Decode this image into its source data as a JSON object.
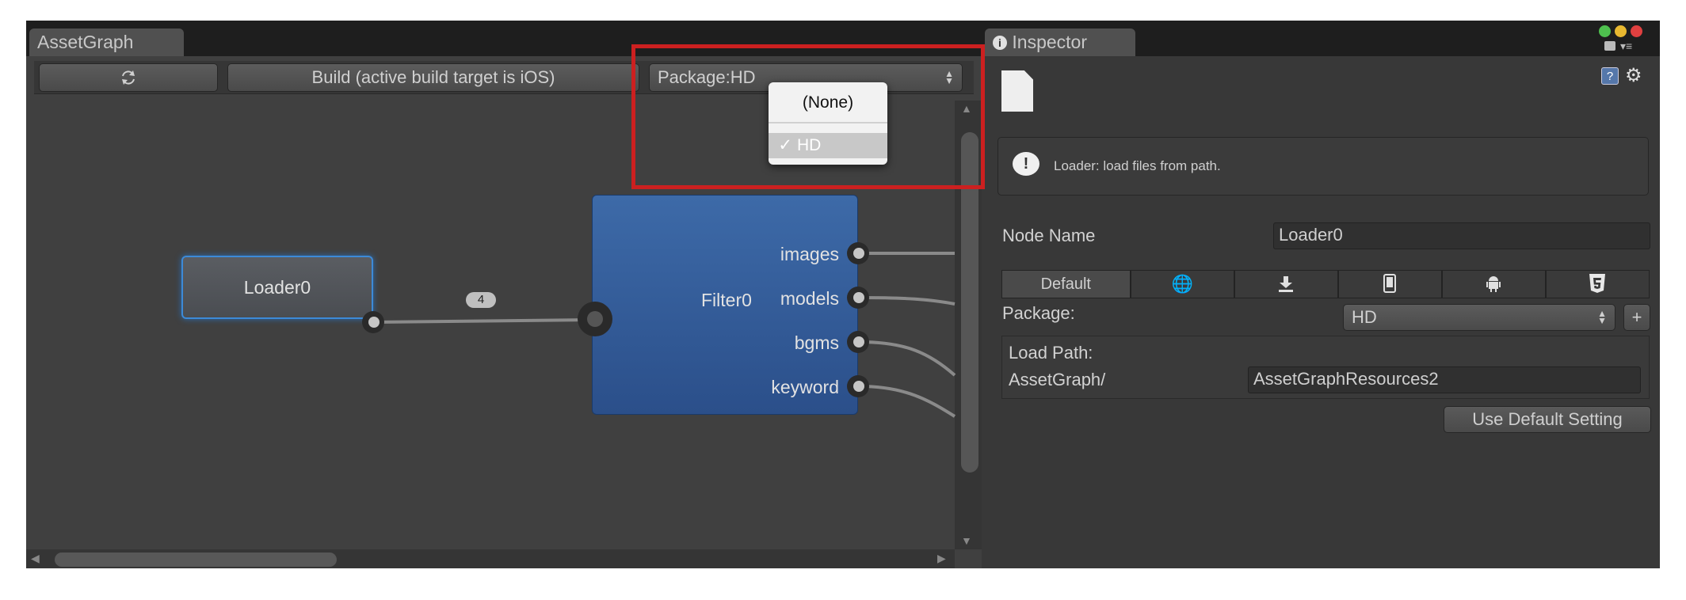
{
  "asset_graph": {
    "tab_label": "AssetGraph",
    "toolbar": {
      "refresh_icon": "refresh-icon",
      "build_label": "Build (active build target is iOS)",
      "package_select_value": "Package:HD"
    },
    "package_menu": {
      "options": [
        "(None)",
        "HD"
      ],
      "selected": "HD",
      "check_mark": "✓"
    },
    "nodes": {
      "loader": {
        "name": "Loader0",
        "connection_count": "4"
      },
      "filter": {
        "name": "Filter0",
        "outputs": [
          "images",
          "models",
          "bgms",
          "keyword"
        ]
      }
    }
  },
  "inspector": {
    "tab_label": "Inspector",
    "tab_icon": "info-icon",
    "info_message": "Loader: load files from path.",
    "node_name_label": "Node Name",
    "node_name_value": "Loader0",
    "platform_tabs": [
      {
        "label": "Default",
        "icon": ""
      },
      {
        "label": "",
        "icon": "globe-icon"
      },
      {
        "label": "",
        "icon": "download-icon"
      },
      {
        "label": "",
        "icon": "phone-icon"
      },
      {
        "label": "",
        "icon": "android-icon"
      },
      {
        "label": "",
        "icon": "html5-icon"
      }
    ],
    "package_label": "Package:",
    "package_value": "HD",
    "add_button": "+",
    "load_path_label": "Load Path:",
    "load_path_prefix": "AssetGraph/",
    "load_path_value": "AssetGraphResources2",
    "use_default_button": "Use Default Setting"
  },
  "colors": {
    "highlight": "#cc2020",
    "filter_node": "#2f5a96",
    "loader_selection": "#3c8ad8",
    "traffic_green": "#4ec04e",
    "traffic_yellow": "#e8b830",
    "traffic_red": "#e04040"
  }
}
